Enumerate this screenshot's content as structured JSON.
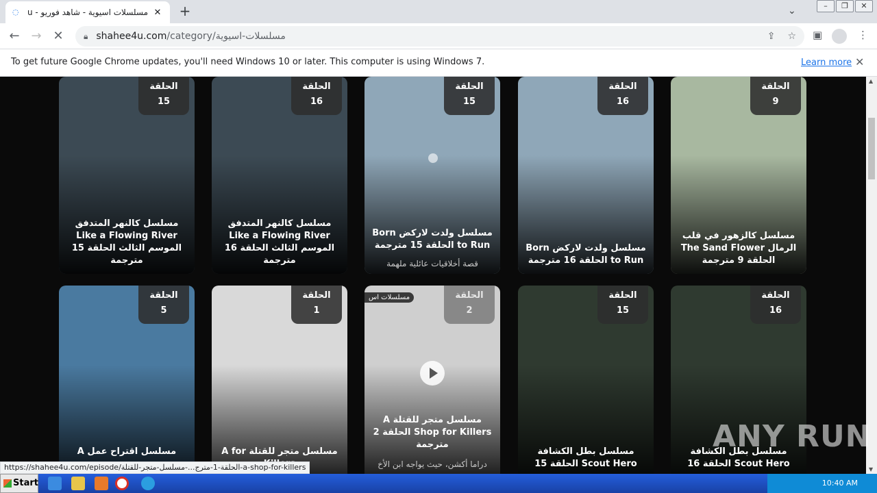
{
  "browser": {
    "tab_title": "مسلسلات اسيوية - شاهد فوريو - 4u",
    "url_host": "shahee4u.com",
    "url_path": "/category/مسلسلات-اسيوية",
    "infobar_message": "To get future Google Chrome updates, you'll need Windows 10 or later. This computer is using Windows 7.",
    "infobar_link": "Learn more",
    "status_url": "https://shahee4u.com/episode/الحلقة-1-مترج...-مسلسل-متجر-للقتلة-a-shop-for-killers"
  },
  "ep_label": "الحلقة",
  "cards": [
    {
      "ep": "15",
      "title": "مسلسل كالنهر المتدفق Like a Flowing River الموسم الثالث الحلقة 15 مترجمة",
      "desc": "",
      "color": "#3c4a54"
    },
    {
      "ep": "16",
      "title": "مسلسل كالنهر المتدفق Like a Flowing River الموسم الثالث الحلقة 16 مترجمة",
      "desc": "",
      "color": "#3c4a54"
    },
    {
      "ep": "15",
      "title": "مسلسل ولدت لاركض Born to Run الحلقة 15 مترجمة",
      "desc": "قصة أخلاقيات عائلية ملهمة",
      "color": "#8fa7b8"
    },
    {
      "ep": "16",
      "title": "مسلسل ولدت لاركض Born to Run الحلقة 16 مترجمة",
      "desc": "",
      "color": "#8fa7b8"
    },
    {
      "ep": "9",
      "title": "مسلسل كالزهور في قلب الرمال The Sand Flower الحلقة 9 مترجمة",
      "desc": "",
      "color": "#a8b8a0"
    },
    {
      "ep": "5",
      "title": "مسلسل اقتراح عمل A",
      "desc": "",
      "color": "#4a7aa0"
    },
    {
      "ep": "1",
      "title": "مسلسل متجر للقتلة A for Killers",
      "desc": "",
      "color": "#d9d9d9"
    },
    {
      "ep": "2",
      "title": "مسلسل متجر للقتلة A Shop for Killers الحلقة 2 مترجمة",
      "desc": "دراما أكشن، حيث يواجه ابن الأخ",
      "color": "#cfcfcf",
      "category": "مسلسلات اس"
    },
    {
      "ep": "15",
      "title": "مسلسل بطل الكشافة Scout Hero الحلقة 15",
      "desc": "",
      "color": "#2f3a30"
    },
    {
      "ep": "16",
      "title": "مسلسل بطل الكشافة Scout Hero الحلقة 16",
      "desc": "",
      "color": "#2f3a30"
    }
  ],
  "watermark": "ANY RUN",
  "taskbar": {
    "start": "Start",
    "clock": "10:40 AM"
  }
}
